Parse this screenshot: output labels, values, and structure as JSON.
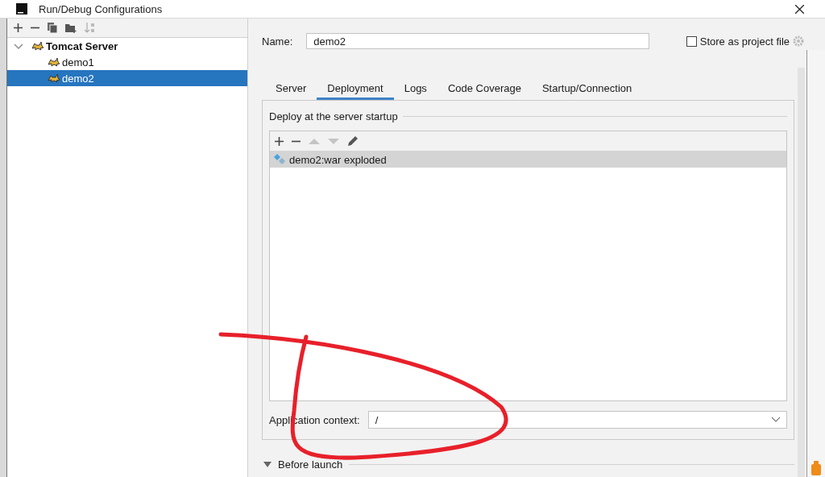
{
  "window": {
    "title": "Run/Debug Configurations"
  },
  "tree": [
    {
      "label": "Tomcat Server",
      "expanded": true,
      "selected": false,
      "children": [
        {
          "label": "demo1",
          "selected": false
        },
        {
          "label": "demo2",
          "selected": true
        }
      ]
    }
  ],
  "name_field": {
    "label": "Name:",
    "value": "demo2"
  },
  "store_as_project_file": {
    "label": "Store as project file",
    "checked": false
  },
  "tabs": [
    {
      "label": "Server",
      "selected": false
    },
    {
      "label": "Deployment",
      "selected": true
    },
    {
      "label": "Logs",
      "selected": false
    },
    {
      "label": "Code Coverage",
      "selected": false
    },
    {
      "label": "Startup/Connection",
      "selected": false
    }
  ],
  "deploy_section": {
    "title": "Deploy at the server startup",
    "items": [
      {
        "label": "demo2:war exploded",
        "selected": true
      }
    ]
  },
  "application_context": {
    "label": "Application context:",
    "value": "/"
  },
  "before_launch": {
    "label": "Before launch",
    "expanded": false
  }
}
